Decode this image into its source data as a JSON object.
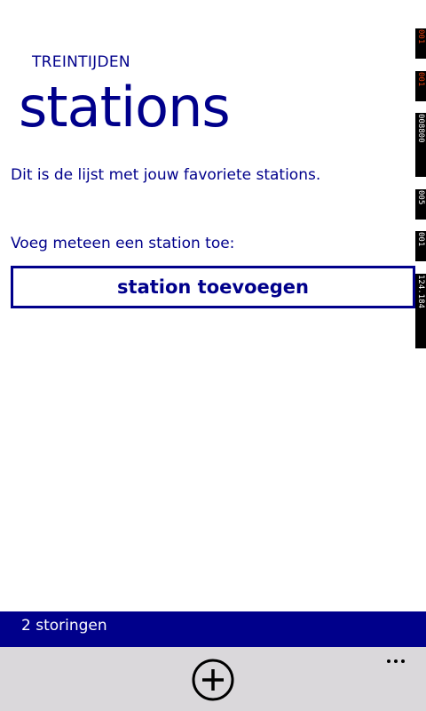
{
  "header": {
    "app_title": "TREINTIJDEN",
    "page_title": "stations"
  },
  "main": {
    "intro": "Dit is de lijst met jouw favoriete stations.",
    "prompt": "Voeg meteen een station toe:",
    "add_station_label": "station toevoegen"
  },
  "debug_counters": [
    "001",
    "001",
    "008800",
    "005",
    "001",
    "124.184"
  ],
  "notification_bar": {
    "label": "2 storingen"
  },
  "app_bar": {
    "add_icon": "plus-circle-icon",
    "more_icon": "more-dots-icon"
  },
  "colors": {
    "accent": "#00008b",
    "background": "#ffffff",
    "app_bar": "#dad8db",
    "debug_highlight": "#e04010"
  }
}
